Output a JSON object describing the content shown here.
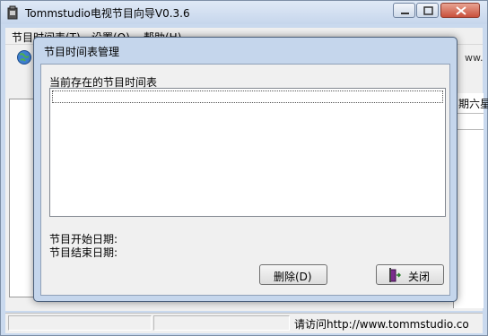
{
  "main_window": {
    "title": "Tommstudio电视节目向导V0.3.6",
    "menu": [
      "节目时间表(T)",
      "设置(O)",
      "帮助(H)"
    ],
    "toolbar_url_fragment": "ww.",
    "column_header": "期六星",
    "status_text": "请访问http://www.tommstudio.co"
  },
  "dialog": {
    "title": "节目时间表管理",
    "list_label": "当前存在的节目时间表",
    "start_date_label": "节目开始日期:",
    "end_date_label": "节目结束日期:",
    "delete_button": "删除(D)",
    "close_button": "关闭"
  },
  "colors": {
    "frame": "#c5d6ec",
    "client": "#f0f0f0",
    "close_button_red": "#c9503c"
  },
  "icons": [
    "app-icon",
    "globe-icon",
    "minimize-icon",
    "maximize-icon",
    "close-icon",
    "exit-door-icon"
  ]
}
